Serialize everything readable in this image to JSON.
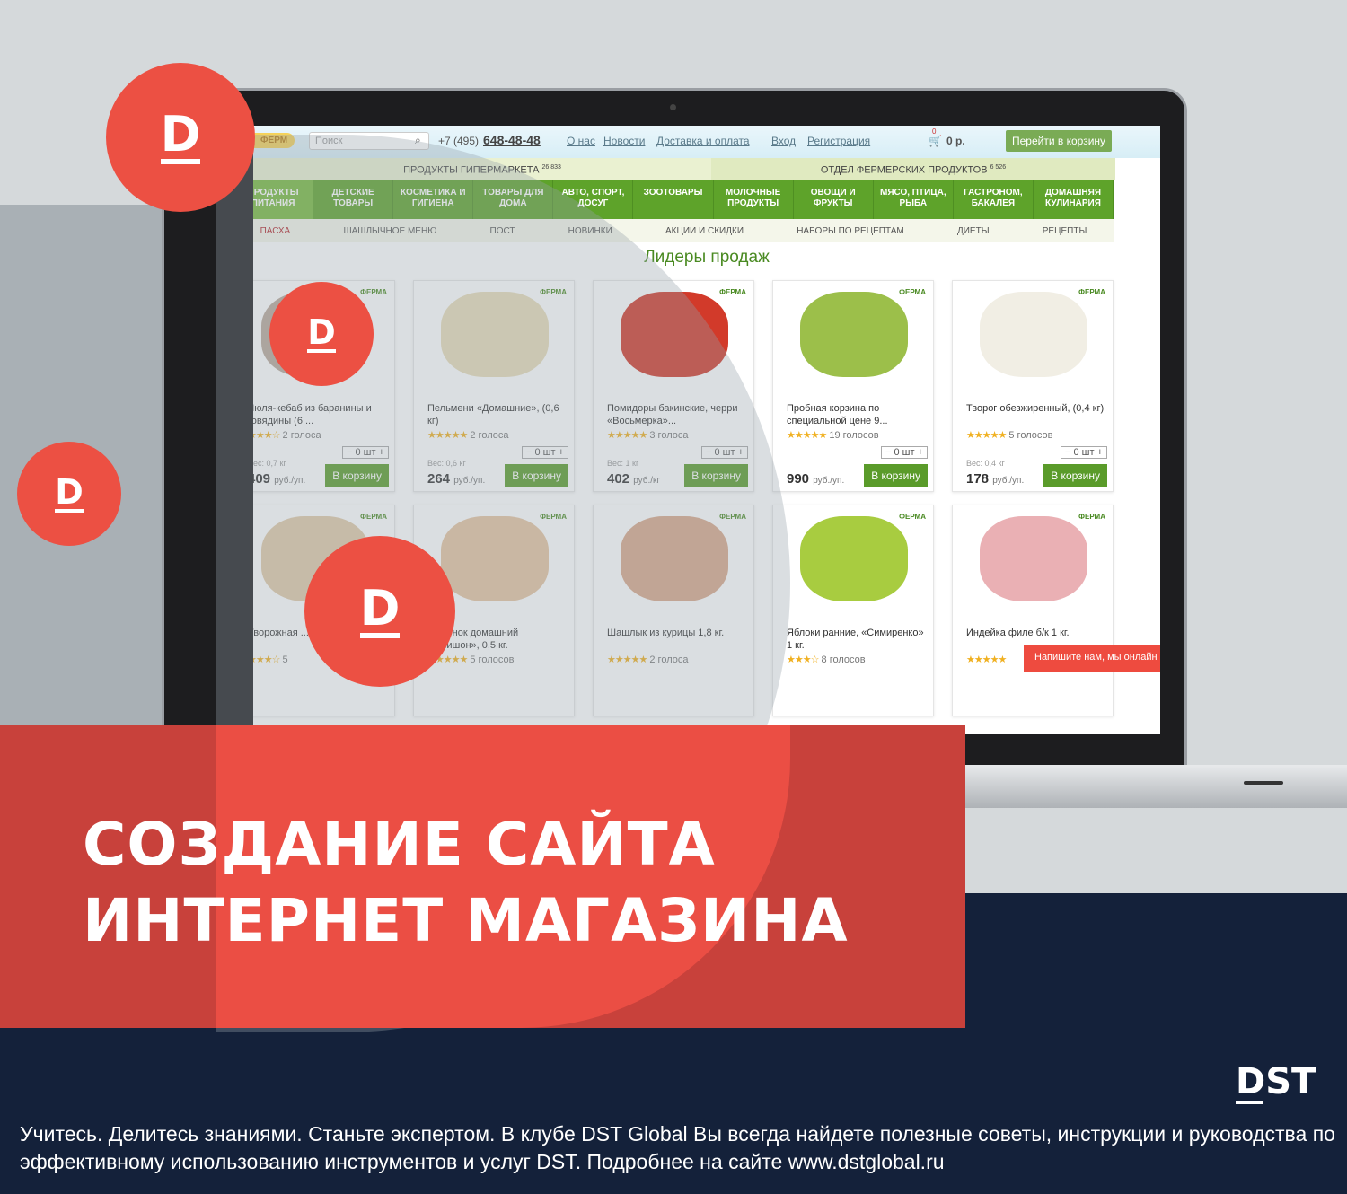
{
  "header": {
    "logo": "ФЕРМ",
    "search_placeholder": "Поиск",
    "phone_prefix": "+7 (495)",
    "phone": "648-48-48",
    "links": [
      "О нас",
      "Новости",
      "Доставка и оплата"
    ],
    "login": "Вход",
    "register": "Регистрация",
    "cart_count": "0",
    "cart_total": "0 р.",
    "cart_button": "Перейти в корзину"
  },
  "sections": [
    {
      "label": "ПРОДУКТЫ ГИПЕРМАРКЕТА",
      "count": "26 833"
    },
    {
      "label": "ОТДЕЛ ФЕРМЕРСКИХ ПРОДУКТОВ",
      "count": "6 526"
    }
  ],
  "categories": [
    "ПРОДУКТЫ ПИТАНИЯ",
    "ДЕТСКИЕ ТОВАРЫ",
    "КОСМЕТИКА И ГИГИЕНА",
    "ТОВАРЫ ДЛЯ ДОМА",
    "АВТО, СПОРТ, ДОСУГ",
    "ЗООТОВАРЫ",
    "МОЛОЧНЫЕ ПРОДУКТЫ",
    "ОВОЩИ И ФРУКТЫ",
    "МЯСО, ПТИЦА, РЫБА",
    "ГАСТРОНОМ, БАКАЛЕЯ",
    "ДОМАШНЯЯ КУЛИНАРИЯ"
  ],
  "subnav": [
    "ПАСХА",
    "ШАШЛЫЧНОЕ МЕНЮ",
    "ПОСТ",
    "НОВИНКИ",
    "АКЦИИ И СКИДКИ",
    "НАБОРЫ ПО РЕЦЕПТАМ",
    "ДИЕТЫ",
    "РЕЦЕПТЫ"
  ],
  "section_title": "Лидеры продаж",
  "badge": "ФЕРМА",
  "qty": "0 шт",
  "buy_label": "В корзину",
  "products": [
    {
      "name": "Люля-кебаб из баранины и говядины (6 ...",
      "rating": 3.5,
      "votes": "2 голоса",
      "weight": "Вес: 0,7 кг",
      "price": "409",
      "unit": "руб./уп.",
      "color": "#b9a89a"
    },
    {
      "name": "Пельмени «Домашние», (0,6 кг)",
      "rating": 5,
      "votes": "2 голоса",
      "weight": "Вес: 0,6 кг",
      "price": "264",
      "unit": "руб./уп.",
      "color": "#e8dcb8"
    },
    {
      "name": "Помидоры бакинские, черри «Восьмерка»...",
      "rating": 5,
      "votes": "3 голоса",
      "weight": "Вес: 1 кг",
      "price": "402",
      "unit": "руб./кг",
      "color": "#d23a2a"
    },
    {
      "name": "Пробная корзина по специальной цене 9...",
      "rating": 5,
      "votes": "19 голосов",
      "weight": "",
      "price": "990",
      "unit": "руб./уп.",
      "color": "#9cbf4a"
    },
    {
      "name": "Творог обезжиренный, (0,4 кг)",
      "rating": 5,
      "votes": "5 голосов",
      "weight": "Вес: 0,4 кг",
      "price": "178",
      "unit": "руб./уп.",
      "color": "#f1eee4"
    },
    {
      "name": "Творожная ... изюмом (0,4 ...",
      "rating": 3.5,
      "votes": "5",
      "color": "#e0c9a8"
    },
    {
      "name": "...пленок домашний «...нишон», 0,5 кг.",
      "rating": 5,
      "votes": "5 голосов",
      "color": "#e5c3a0"
    },
    {
      "name": "Шашлык из курицы 1,8 кг.",
      "rating": 5,
      "votes": "2 голоса",
      "color": "#d9a88a"
    },
    {
      "name": "Яблоки ранние, «Симиренко» 1 кг.",
      "rating": 3.5,
      "votes": "8 голосов",
      "color": "#a8cc40"
    },
    {
      "name": "Индейка филе б/к 1 кг.",
      "rating": 5,
      "votes": "",
      "color": "#eab0b4"
    }
  ],
  "chat": "Напишите нам, мы онлайн",
  "promo": {
    "line1": "СОЗДАНИЕ САЙТА",
    "line2": "ИНТЕРНЕТ МАГАЗИНА",
    "brand": "DST",
    "d": "D",
    "footer": "Учитесь. Делитесь знаниями. Станьте экспертом. В клубе DST Global Вы всегда найдете полезные советы, инструкции и руководства по эффективному использованию инструментов и услуг DST. Подробнее на сайте www.dstglobal.ru"
  },
  "colors": {
    "accent_red": "#ec5043",
    "navy": "#14213a",
    "shop_green": "#5ea32a"
  }
}
